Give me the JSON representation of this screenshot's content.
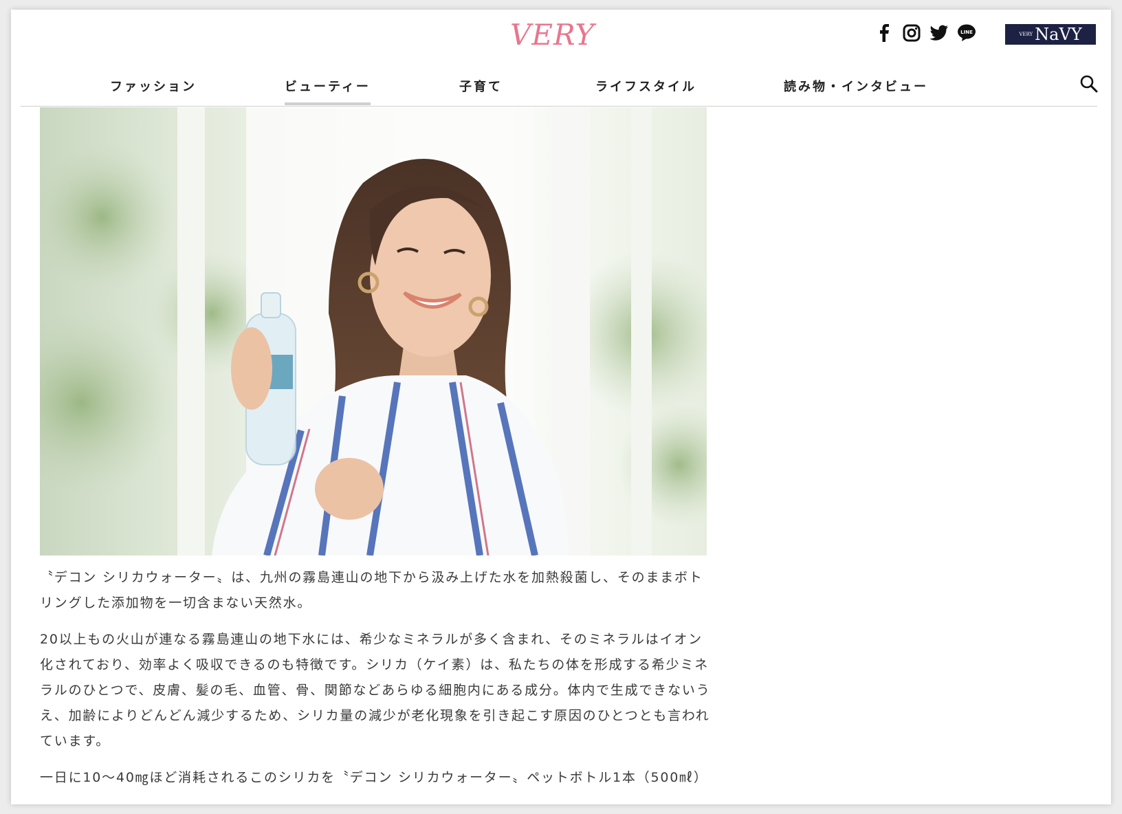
{
  "header": {
    "logo_text": "VERY",
    "logo_color": "#e8768e",
    "social_icons": [
      "facebook-icon",
      "instagram-icon",
      "twitter-icon",
      "line-icon"
    ],
    "badge": {
      "prefix": "VERY",
      "text": "NaVY",
      "color": "#1d2143"
    }
  },
  "nav": {
    "items": [
      {
        "label": "ファッション"
      },
      {
        "label": "ビューティー",
        "active": true
      },
      {
        "label": "子育て"
      },
      {
        "label": "ライフスタイル"
      },
      {
        "label": "読み物・インタビュー"
      }
    ],
    "search_icon": "search-icon"
  },
  "article": {
    "paragraphs": [
      "〝デコン シリカウォーター〟は、九州の霧島連山の地下から汲み上げた水を加熱殺菌し、そのままボトリングした添加物を一切含まない天然水。",
      "20以上もの火山が連なる霧島連山の地下水には、希少なミネラルが多く含まれ、そのミネラルはイオン化されており、効率よく吸収できるのも特徴です。シリカ（ケイ素）は、私たちの体を形成する希少ミネラルのひとつで、皮膚、髪の毛、血管、骨、関節などあらゆる細胞内にある成分。体内で生成できないうえ、加齢によりどんどん減少するため、シリカ量の減少が老化現象を引き起こす原因のひとつとも言われています。",
      "一日に10～40㎎ほど消耗されるこのシリカを〝デコン シリカウォーター〟ペットボトル1本（500㎖）"
    ]
  }
}
